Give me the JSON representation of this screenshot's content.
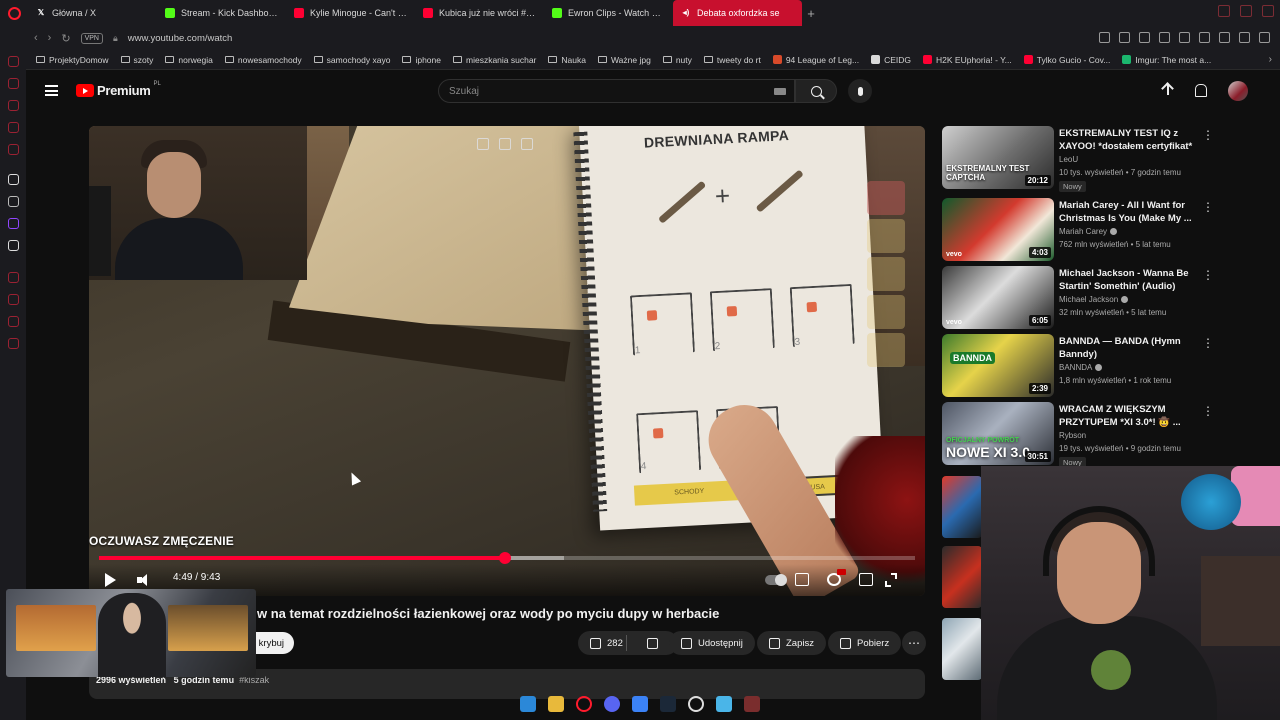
{
  "browser": {
    "tabs": [
      {
        "title": "Główna / X",
        "fav": "x-logo",
        "color": "#ffffff",
        "active": false
      },
      {
        "title": "Stream - Kick Dashboard",
        "fav": "kick-logo",
        "color": "#53fc18",
        "active": false
      },
      {
        "title": "Kylie Minogue - Can't Ge",
        "fav": "youtube-logo",
        "color": "#ff0033",
        "active": false
      },
      {
        "title": "Kubica już nie wróci #pa",
        "fav": "youtube-logo",
        "color": "#ff0033",
        "active": false
      },
      {
        "title": "Ewron Clips - Watch Live",
        "fav": "kick-logo",
        "color": "#53fc18",
        "active": false
      },
      {
        "title": "Debata oxfordzka se",
        "fav": "audio-icon",
        "color": "#ffffff",
        "active": true
      }
    ],
    "address": "www.youtube.com/watch",
    "vpn_label": "VPN",
    "bookmarks": [
      {
        "label": "ProjektyDomow",
        "type": "folder"
      },
      {
        "label": "szoty",
        "type": "folder"
      },
      {
        "label": "norwegia",
        "type": "folder"
      },
      {
        "label": "nowesamochody",
        "type": "folder"
      },
      {
        "label": "samochody xayo",
        "type": "folder"
      },
      {
        "label": "iphone",
        "type": "folder"
      },
      {
        "label": "mieszkania suchar",
        "type": "folder"
      },
      {
        "label": "Nauka",
        "type": "folder"
      },
      {
        "label": "Ważne jpg",
        "type": "folder"
      },
      {
        "label": "nuty",
        "type": "folder"
      },
      {
        "label": "tweety do rt",
        "type": "folder"
      },
      {
        "label": "94 League of Leg...",
        "type": "site",
        "color": "#d84a2a"
      },
      {
        "label": "CEIDG",
        "type": "site",
        "color": "#d9d9d9"
      },
      {
        "label": "H2K EUphoria! - Y...",
        "type": "site",
        "color": "#ff0033"
      },
      {
        "label": "Tylko Gucio - Cov...",
        "type": "site",
        "color": "#ff0033"
      },
      {
        "label": "Imgur: The most a...",
        "type": "site",
        "color": "#1bb76e"
      }
    ]
  },
  "youtube": {
    "logo_text": "Premium",
    "logo_region": "PL",
    "search_placeholder": "Szukaj"
  },
  "player": {
    "current_time": "4:49",
    "duration": "9:43",
    "time_display": "4:49 / 9:43",
    "progress_fraction": 0.497,
    "buffered_fraction": 0.57,
    "caption_text": "OCZUWASZ ZMĘCZENIE",
    "notebook_title": "DREWNIANA RAMPA",
    "notebook_numbers": [
      "1",
      "2",
      "3",
      "4",
      "5"
    ],
    "notebook_buttons": [
      "SCHODY",
      "PAUSA"
    ]
  },
  "video": {
    "title": "w na temat rozdzielności łazienkowej oraz wody po myciu dupy w herbacie",
    "subscribe_label": "krybuj",
    "likes": "282",
    "share_label": "Udostępnij",
    "save_label": "Zapisz",
    "download_label": "Pobierz",
    "views": "2996 wyświetleń",
    "age": "5 godzin temu",
    "hashtag": "#kiszak"
  },
  "recommendations": [
    {
      "title": "EKSTREMALNY TEST IQ z XAYOO! *dostałem certyfikat* ...",
      "channel": "LeoU",
      "verified": false,
      "meta": "10 tys. wyświetleń • 7 godzin temu",
      "badge": "Nowy",
      "duration": "20:12",
      "thumb_label": "EKSTREMALNY TEST CAPTCHA",
      "vevo": false
    },
    {
      "title": "Mariah Carey - All I Want for Christmas Is You (Make My ...",
      "channel": "Mariah Carey",
      "verified": true,
      "meta": "762 mln wyświetleń • 5 lat temu",
      "badge": "",
      "duration": "4:03",
      "thumb_label": "",
      "vevo": true
    },
    {
      "title": "Michael Jackson - Wanna Be Startin' Somethin' (Audio)",
      "channel": "Michael Jackson",
      "verified": true,
      "meta": "32 mln wyświetleń • 5 lat temu",
      "badge": "",
      "duration": "6:05",
      "thumb_label": "",
      "vevo": true
    },
    {
      "title": "BANNDA — BANDA (Hymn Banndy)",
      "channel": "BANNDA",
      "verified": true,
      "meta": "1,8 mln wyświetleń • 1 rok temu",
      "badge": "",
      "duration": "2:39",
      "thumb_label": "BANNDA",
      "vevo": false
    },
    {
      "title": "WRACAM Z WIĘKSZYM PRZYTUPEM *XI 3.0*! 🤠 ...",
      "channel": "Rybson",
      "verified": false,
      "meta": "19 tys. wyświetleń • 9 godzin temu",
      "badge": "Nowy",
      "duration": "30:51",
      "thumb_label": "NOWE XI 3.0",
      "thumb_sub": "OFICJALNY POWRÓT",
      "vevo": false
    }
  ],
  "colors": {
    "accent": "#ff0033",
    "opera": "#ff1b2d",
    "background": "#0f0f0f",
    "pill": "#272727"
  }
}
